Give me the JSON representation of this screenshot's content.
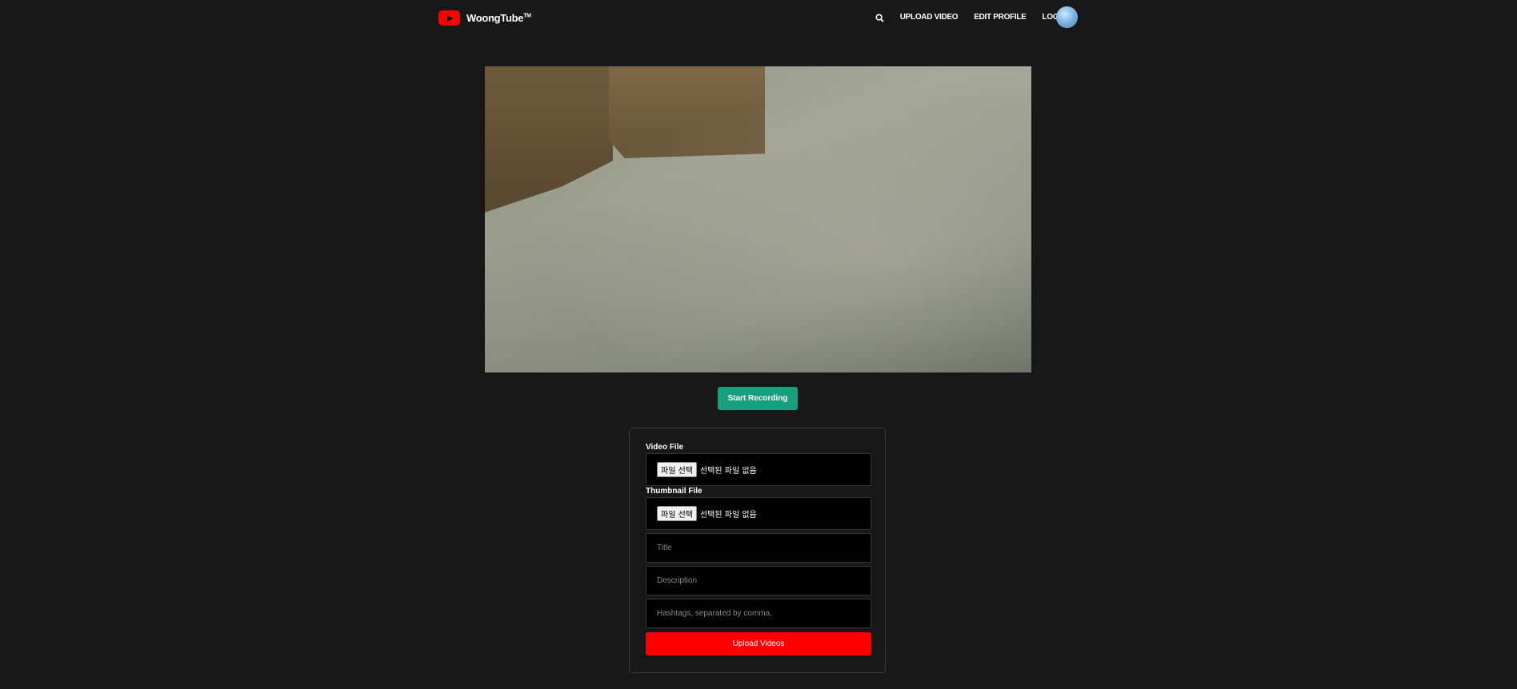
{
  "header": {
    "logo_text": "WoongTube",
    "logo_tm": "TM",
    "nav": {
      "search_icon": "search-icon",
      "upload_video": "UPLOAD VIDEO",
      "edit_profile": "EDIT PROFILE",
      "log_out": "LOG OUT"
    }
  },
  "recorder": {
    "start_label": "Start Recording",
    "start_color": "#16a07e"
  },
  "form": {
    "video_file_label": "Video File",
    "thumbnail_file_label": "Thumbnail File",
    "file_button": "파일 선택",
    "file_status": "선택된 파일 없음",
    "title_placeholder": "Title",
    "description_placeholder": "Description",
    "hashtags_placeholder": "Hashtags, separated by comma.",
    "submit_label": "Upload Videos",
    "submit_color": "#ff0000"
  }
}
